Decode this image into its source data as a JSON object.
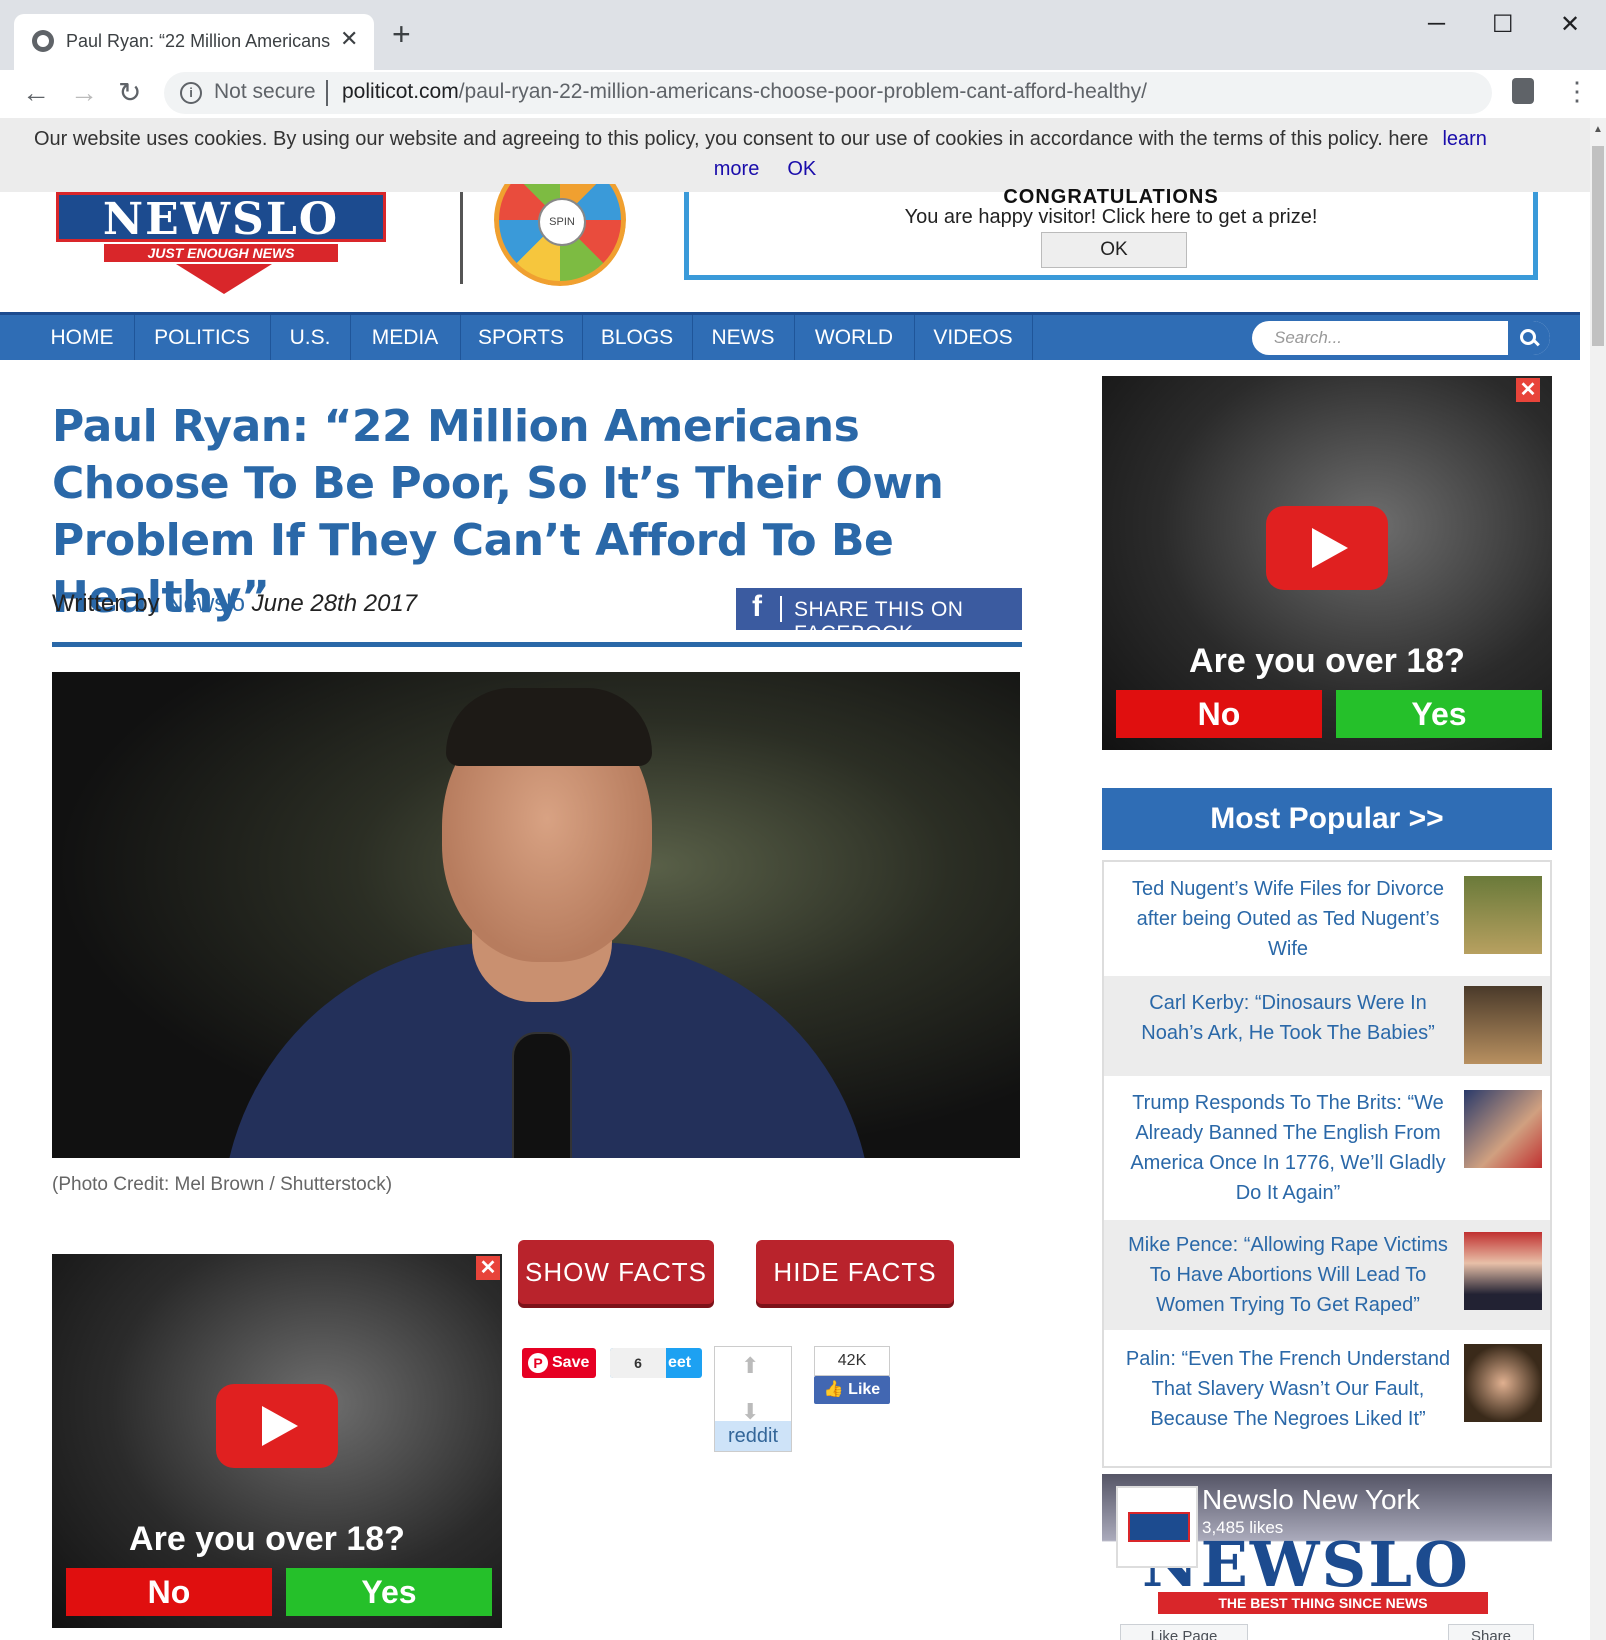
{
  "browser": {
    "tab_title": "Paul Ryan: “22 Million Americans",
    "tab_close": "✕",
    "new_tab": "+",
    "win_min": "─",
    "win_max": "☐",
    "win_close": "✕",
    "back": "←",
    "forward": "→",
    "reload": "↻",
    "security_label": "Not secure",
    "url_host": "politicot.com",
    "url_path": "/paul-ryan-22-million-americans-choose-poor-problem-cant-afford-healthy/",
    "menu": "⋮"
  },
  "cookie_bar": {
    "text": "Our website uses cookies. By using our website and agreeing to this policy, you consent to our use of cookies in accordance with the terms of this policy. here",
    "learn": "learn",
    "more": "more",
    "ok": "OK"
  },
  "header": {
    "logo_word": "NEWSLO",
    "logo_tag": "JUST ENOUGH NEWS",
    "wheel_label": "SPIN",
    "prize_title": "CONGRATULATIONS",
    "prize_msg": "You are happy visitor! Click here to get a prize!",
    "prize_ok": "OK"
  },
  "nav": {
    "items": [
      "HOME",
      "POLITICS",
      "U.S.",
      "MEDIA",
      "SPORTS",
      "BLOGS",
      "NEWS",
      "WORLD",
      "VIDEOS"
    ],
    "search_placeholder": "Search..."
  },
  "article": {
    "headline": "Paul Ryan: “22 Million Americans Choose To Be Poor, So It’s Their Own Problem If They Can’t Afford To Be Healthy”",
    "written_by": "Written by",
    "author": "Newslo",
    "date": "June 28th 2017",
    "share_label": "SHARE THIS ON FACEBOOK",
    "photo_credit": "(Photo Credit: Mel Brown / Shutterstock)"
  },
  "ads": {
    "question": "Are you over 18?",
    "no": "No",
    "yes": "Yes",
    "close": "✕"
  },
  "facts": {
    "show": "SHOW FACTS",
    "hide": "HIDE FACTS"
  },
  "social": {
    "pin_save": "Save",
    "tweet_count": "6",
    "tweet_label": "eet",
    "reddit_label": "reddit",
    "fb_count": "42K",
    "fb_like": "Like"
  },
  "sidebar": {
    "popular_title": "Most Popular >>",
    "popular": [
      "Ted Nugent’s Wife Files for Divorce after being Outed as Ted Nugent’s Wife",
      "Carl Kerby: “Dinosaurs Were In Noah’s Ark, He Took The Babies”",
      "Trump Responds To The Brits: “We Already Banned The English From America Once In 1776, We’ll Gladly Do It Again”",
      "Mike Pence: “Allowing Rape Victims To Have Abortions Will Lead To Women Trying To Get Raped”",
      "Palin: “Even The French Understand That Slavery Wasn’t Our Fault, Because The Negroes Liked It”"
    ],
    "fb_page_name": "Newslo New York",
    "fb_page_likes": "3,485 likes",
    "fb_page_logo": "NEWSLO",
    "fb_page_tag": "THE BEST THING SINCE NEWS",
    "fb_like_page": "Like Page",
    "fb_share": "Share"
  }
}
